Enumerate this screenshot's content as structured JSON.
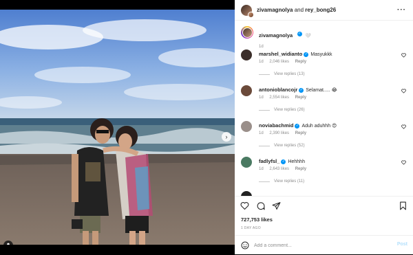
{
  "header": {
    "user1": "zivamagnolya",
    "joiner": "and",
    "user2": "rey_bong26"
  },
  "caption": {
    "username": "zivamagnolya",
    "verified_mark": "✓",
    "emoji": "🤍",
    "time": "1d"
  },
  "comments": [
    {
      "username": "marshel_widianto",
      "verified": true,
      "text": "Masyukkk",
      "time": "1d",
      "likes": "2,046 likes",
      "reply": "Reply",
      "view_replies": "View replies (13)",
      "avatar_color": "#3b2e2a"
    },
    {
      "username": "antonioblancojr",
      "verified": true,
      "text": "Selamat..... 😂",
      "time": "1d",
      "likes": "2,554 likes",
      "reply": "Reply",
      "view_replies": "View replies (26)",
      "avatar_color": "#6b4a3a"
    },
    {
      "username": "noviabachmid",
      "verified": true,
      "text": "Aduh aduhhh 😍",
      "time": "1d",
      "likes": "2,390 likes",
      "reply": "Reply",
      "view_replies": "View replies (52)",
      "avatar_color": "#9a8f8a"
    },
    {
      "username": "fadlyfsl_",
      "verified": true,
      "text": "Hehhhh",
      "time": "1d",
      "likes": "2,643 likes",
      "reply": "Reply",
      "view_replies": "View replies (11)",
      "avatar_color": "#4a7a62"
    }
  ],
  "actions": {
    "likes": "727,753 likes",
    "ago": "1 DAY AGO"
  },
  "add_comment": {
    "placeholder": "Add a comment...",
    "post_label": "Post"
  },
  "colors": {
    "link_blue": "#0095f6",
    "post_disabled": "#b2dffc",
    "muted": "#8e8e8e"
  }
}
